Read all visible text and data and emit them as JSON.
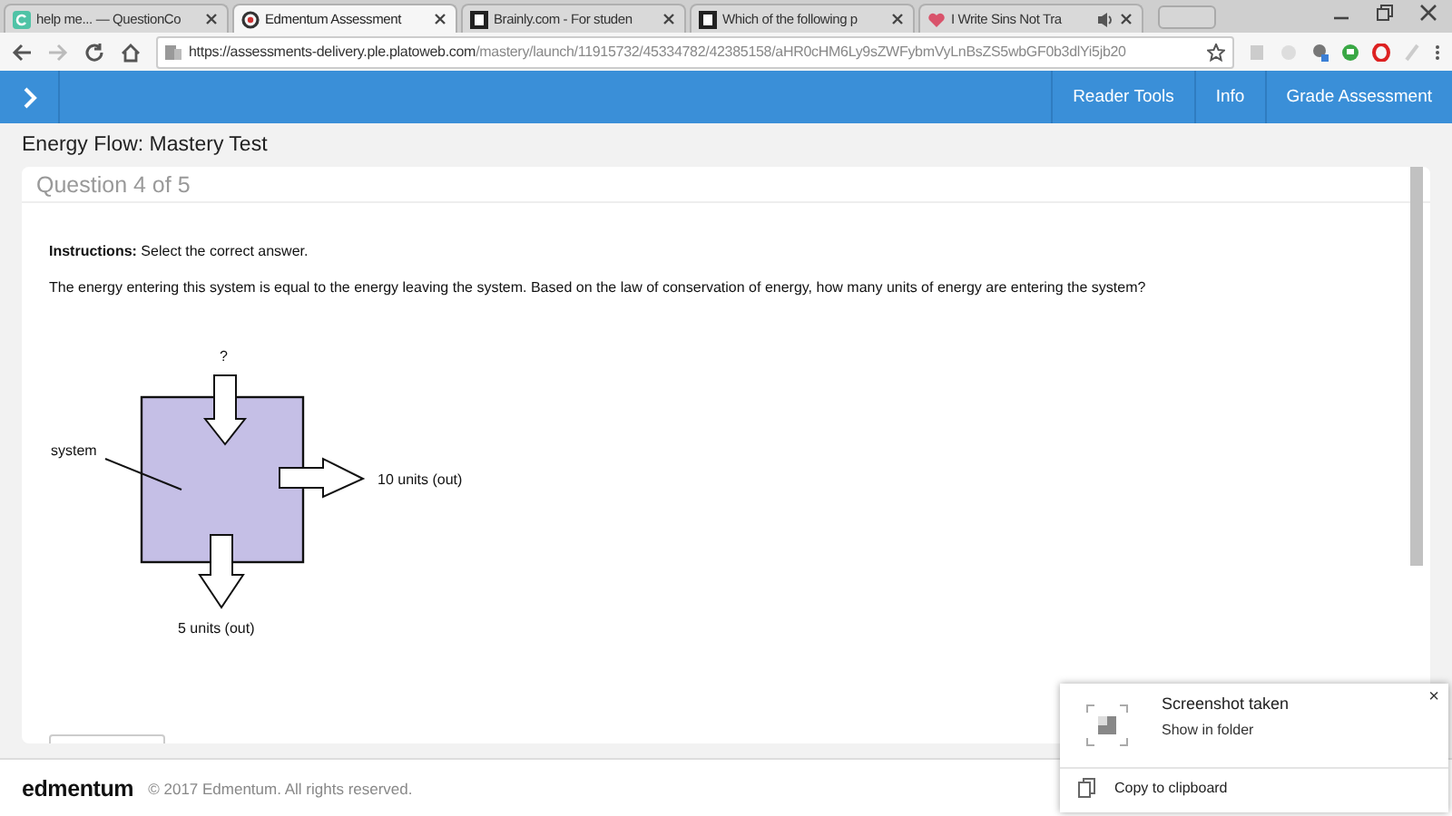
{
  "browser": {
    "tabs": [
      {
        "title": "help me... — QuestionCo",
        "kind": "green",
        "selected": false,
        "audio": false
      },
      {
        "title": "Edmentum Assessment",
        "kind": "ring",
        "selected": true,
        "audio": false
      },
      {
        "title": "Brainly.com - For studen",
        "kind": "dark",
        "selected": false,
        "audio": false
      },
      {
        "title": "Which of the following p",
        "kind": "dark",
        "selected": false,
        "audio": false
      },
      {
        "title": "I Write Sins Not Tra",
        "kind": "heart",
        "selected": false,
        "audio": true
      }
    ],
    "url_host": "https://assessments-delivery.ple.platoweb.com",
    "url_path": "/mastery/launch/11915732/45334782/42385158/aHR0cHM6Ly9sZWFybmVyLnBsZS5wbGF0b3dlYi5jb20"
  },
  "app_bar": {
    "buttons": [
      "Reader Tools",
      "Info",
      "Grade Assessment"
    ]
  },
  "page_title": "Energy Flow: Mastery Test",
  "question": {
    "heading": "Question 4 of 5",
    "instructions": "**Instructions:** Select the correct answer.",
    "prompt": "The energy entering this system is equal to the energy leaving the system. Based on the law of conservation of energy, how many units of energy are entering the system?",
    "diagram": {
      "input_label": "?",
      "system_label": "system",
      "right_output_label": "10 units (out)",
      "bottom_output_label": "5 units (out)"
    }
  },
  "footer": {
    "logo": "edmentum",
    "copyright": "© 2017 Edmentum. All rights reserved."
  },
  "notification": {
    "title": "Screenshot taken",
    "link": "Show in folder",
    "action": "Copy to clipboard",
    "close": "×"
  }
}
